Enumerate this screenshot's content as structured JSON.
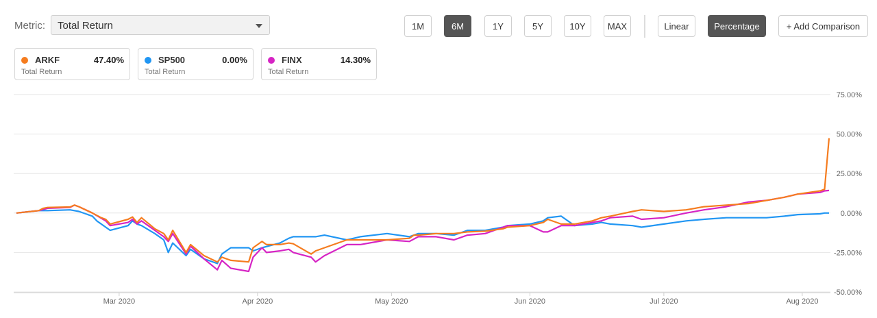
{
  "metric": {
    "label": "Metric:",
    "value": "Total Return"
  },
  "ranges": [
    "1M",
    "6M",
    "1Y",
    "5Y",
    "10Y",
    "MAX"
  ],
  "active_range": "6M",
  "scale_buttons": {
    "linear": "Linear",
    "percentage": "Percentage",
    "active": "Percentage"
  },
  "add_comparison": "+ Add Comparison",
  "cards": [
    {
      "symbol": "ARKF",
      "value": "47.40%",
      "sub": "Total Return",
      "color": "#f57c1f"
    },
    {
      "symbol": "SP500",
      "value": "0.00%",
      "sub": "Total Return",
      "color": "#2196f3"
    },
    {
      "symbol": "FINX",
      "value": "14.30%",
      "sub": "Total Return",
      "color": "#d624c4"
    }
  ],
  "chart_data": {
    "type": "line",
    "title": "",
    "xlabel": "",
    "ylabel": "",
    "ylim": [
      -50,
      75
    ],
    "yticks": [
      "75.00%",
      "50.00%",
      "25.00%",
      "0.00%",
      "-25.00%",
      "-50.00%"
    ],
    "ytick_values": [
      75,
      50,
      25,
      0,
      -25,
      -50
    ],
    "xticks": [
      "Mar 2020",
      "Apr 2020",
      "May 2020",
      "Jun 2020",
      "Jul 2020",
      "Aug 2020"
    ],
    "xtick_values": [
      "2020-03-01",
      "2020-04-01",
      "2020-05-01",
      "2020-06-01",
      "2020-07-01",
      "2020-08-01"
    ],
    "x_range": [
      "2020-02-07",
      "2020-08-07"
    ],
    "grid": true,
    "series": [
      {
        "name": "ARKF",
        "color": "#f57c1f",
        "points": [
          [
            "2020-02-07",
            0
          ],
          [
            "2020-02-12",
            1.5
          ],
          [
            "2020-02-13",
            3
          ],
          [
            "2020-02-14",
            3.5
          ],
          [
            "2020-02-19",
            3.8
          ],
          [
            "2020-02-20",
            5
          ],
          [
            "2020-02-21",
            4
          ],
          [
            "2020-02-24",
            0
          ],
          [
            "2020-02-26",
            -3
          ],
          [
            "2020-02-27",
            -4
          ],
          [
            "2020-02-28",
            -7
          ],
          [
            "2020-03-03",
            -4
          ],
          [
            "2020-03-04",
            -2.5
          ],
          [
            "2020-03-05",
            -6
          ],
          [
            "2020-03-06",
            -3
          ],
          [
            "2020-03-09",
            -10
          ],
          [
            "2020-03-11",
            -13
          ],
          [
            "2020-03-12",
            -17
          ],
          [
            "2020-03-13",
            -11
          ],
          [
            "2020-03-16",
            -25
          ],
          [
            "2020-03-17",
            -20
          ],
          [
            "2020-03-20",
            -27
          ],
          [
            "2020-03-23",
            -31
          ],
          [
            "2020-03-24",
            -28
          ],
          [
            "2020-03-26",
            -30
          ],
          [
            "2020-03-30",
            -31
          ],
          [
            "2020-03-31",
            -22
          ],
          [
            "2020-04-02",
            -18
          ],
          [
            "2020-04-03",
            -20
          ],
          [
            "2020-04-06",
            -20
          ],
          [
            "2020-04-08",
            -19
          ],
          [
            "2020-04-09",
            -19.5
          ],
          [
            "2020-04-13",
            -26
          ],
          [
            "2020-04-14",
            -24
          ],
          [
            "2020-04-16",
            -22
          ],
          [
            "2020-04-21",
            -17
          ],
          [
            "2020-04-24",
            -17
          ],
          [
            "2020-04-30",
            -17
          ],
          [
            "2020-05-05",
            -16
          ],
          [
            "2020-05-06",
            -14
          ],
          [
            "2020-05-07",
            -14
          ],
          [
            "2020-05-11",
            -13
          ],
          [
            "2020-05-15",
            -13
          ],
          [
            "2020-05-18",
            -12
          ],
          [
            "2020-05-22",
            -11.5
          ],
          [
            "2020-05-26",
            -10
          ],
          [
            "2020-05-27",
            -9
          ],
          [
            "2020-06-01",
            -8
          ],
          [
            "2020-06-04",
            -6
          ],
          [
            "2020-06-05",
            -4
          ],
          [
            "2020-06-08",
            -7
          ],
          [
            "2020-06-11",
            -7
          ],
          [
            "2020-06-15",
            -5
          ],
          [
            "2020-06-17",
            -3
          ],
          [
            "2020-06-19",
            -2
          ],
          [
            "2020-06-24",
            1
          ],
          [
            "2020-06-26",
            2
          ],
          [
            "2020-07-01",
            1
          ],
          [
            "2020-07-06",
            2
          ],
          [
            "2020-07-10",
            4
          ],
          [
            "2020-07-15",
            5
          ],
          [
            "2020-07-20",
            6
          ],
          [
            "2020-07-24",
            8
          ],
          [
            "2020-07-28",
            10
          ],
          [
            "2020-07-31",
            12
          ],
          [
            "2020-08-05",
            14
          ],
          [
            "2020-08-06",
            15
          ],
          [
            "2020-08-07",
            47.4
          ]
        ]
      },
      {
        "name": "SP500",
        "color": "#2196f3",
        "points": [
          [
            "2020-02-07",
            0
          ],
          [
            "2020-02-12",
            1.5
          ],
          [
            "2020-02-14",
            1.5
          ],
          [
            "2020-02-19",
            2
          ],
          [
            "2020-02-21",
            1
          ],
          [
            "2020-02-24",
            -2
          ],
          [
            "2020-02-25",
            -5
          ],
          [
            "2020-02-27",
            -9
          ],
          [
            "2020-02-28",
            -11
          ],
          [
            "2020-03-03",
            -8
          ],
          [
            "2020-03-04",
            -5
          ],
          [
            "2020-03-05",
            -7
          ],
          [
            "2020-03-06",
            -8
          ],
          [
            "2020-03-09",
            -13
          ],
          [
            "2020-03-11",
            -17
          ],
          [
            "2020-03-12",
            -25
          ],
          [
            "2020-03-13",
            -19
          ],
          [
            "2020-03-16",
            -27
          ],
          [
            "2020-03-17",
            -23
          ],
          [
            "2020-03-20",
            -29
          ],
          [
            "2020-03-23",
            -32
          ],
          [
            "2020-03-24",
            -26
          ],
          [
            "2020-03-26",
            -22
          ],
          [
            "2020-03-30",
            -22
          ],
          [
            "2020-03-31",
            -24
          ],
          [
            "2020-04-02",
            -22
          ],
          [
            "2020-04-06",
            -19
          ],
          [
            "2020-04-08",
            -16
          ],
          [
            "2020-04-09",
            -15
          ],
          [
            "2020-04-14",
            -15
          ],
          [
            "2020-04-16",
            -14
          ],
          [
            "2020-04-21",
            -17
          ],
          [
            "2020-04-24",
            -15
          ],
          [
            "2020-04-30",
            -13
          ],
          [
            "2020-05-05",
            -15
          ],
          [
            "2020-05-07",
            -13
          ],
          [
            "2020-05-11",
            -13
          ],
          [
            "2020-05-15",
            -14
          ],
          [
            "2020-05-18",
            -11
          ],
          [
            "2020-05-22",
            -11
          ],
          [
            "2020-05-26",
            -9
          ],
          [
            "2020-05-27",
            -8
          ],
          [
            "2020-06-01",
            -7
          ],
          [
            "2020-06-04",
            -5
          ],
          [
            "2020-06-05",
            -3
          ],
          [
            "2020-06-08",
            -2
          ],
          [
            "2020-06-11",
            -8
          ],
          [
            "2020-06-15",
            -7
          ],
          [
            "2020-06-17",
            -6
          ],
          [
            "2020-06-19",
            -7
          ],
          [
            "2020-06-24",
            -8
          ],
          [
            "2020-06-26",
            -9
          ],
          [
            "2020-07-01",
            -7
          ],
          [
            "2020-07-06",
            -5
          ],
          [
            "2020-07-10",
            -4
          ],
          [
            "2020-07-15",
            -3
          ],
          [
            "2020-07-20",
            -3
          ],
          [
            "2020-07-24",
            -3
          ],
          [
            "2020-07-28",
            -2
          ],
          [
            "2020-07-31",
            -1
          ],
          [
            "2020-08-05",
            -0.5
          ],
          [
            "2020-08-06",
            0
          ],
          [
            "2020-08-07",
            0
          ]
        ]
      },
      {
        "name": "FINX",
        "color": "#d624c4",
        "points": [
          [
            "2020-02-07",
            0
          ],
          [
            "2020-02-12",
            1.5
          ],
          [
            "2020-02-14",
            3
          ],
          [
            "2020-02-19",
            3.5
          ],
          [
            "2020-02-20",
            5
          ],
          [
            "2020-02-21",
            4
          ],
          [
            "2020-02-24",
            0
          ],
          [
            "2020-02-27",
            -5
          ],
          [
            "2020-02-28",
            -8
          ],
          [
            "2020-03-03",
            -6
          ],
          [
            "2020-03-04",
            -4
          ],
          [
            "2020-03-05",
            -7
          ],
          [
            "2020-03-06",
            -5
          ],
          [
            "2020-03-09",
            -11
          ],
          [
            "2020-03-11",
            -15
          ],
          [
            "2020-03-12",
            -18
          ],
          [
            "2020-03-13",
            -13
          ],
          [
            "2020-03-16",
            -26
          ],
          [
            "2020-03-17",
            -21
          ],
          [
            "2020-03-20",
            -29
          ],
          [
            "2020-03-23",
            -36
          ],
          [
            "2020-03-24",
            -30
          ],
          [
            "2020-03-26",
            -35
          ],
          [
            "2020-03-30",
            -37
          ],
          [
            "2020-03-31",
            -28
          ],
          [
            "2020-04-02",
            -22
          ],
          [
            "2020-04-03",
            -25
          ],
          [
            "2020-04-06",
            -24
          ],
          [
            "2020-04-08",
            -23
          ],
          [
            "2020-04-09",
            -25
          ],
          [
            "2020-04-13",
            -28
          ],
          [
            "2020-04-14",
            -31
          ],
          [
            "2020-04-16",
            -27
          ],
          [
            "2020-04-21",
            -20
          ],
          [
            "2020-04-24",
            -20
          ],
          [
            "2020-04-30",
            -17
          ],
          [
            "2020-05-05",
            -18
          ],
          [
            "2020-05-07",
            -15
          ],
          [
            "2020-05-11",
            -15
          ],
          [
            "2020-05-15",
            -17
          ],
          [
            "2020-05-18",
            -14
          ],
          [
            "2020-05-22",
            -13
          ],
          [
            "2020-05-26",
            -9
          ],
          [
            "2020-05-27",
            -8
          ],
          [
            "2020-06-01",
            -8
          ],
          [
            "2020-06-04",
            -12
          ],
          [
            "2020-06-05",
            -12
          ],
          [
            "2020-06-08",
            -8
          ],
          [
            "2020-06-11",
            -8
          ],
          [
            "2020-06-15",
            -6
          ],
          [
            "2020-06-17",
            -5
          ],
          [
            "2020-06-19",
            -3
          ],
          [
            "2020-06-24",
            -2
          ],
          [
            "2020-06-26",
            -4
          ],
          [
            "2020-07-01",
            -3
          ],
          [
            "2020-07-06",
            0
          ],
          [
            "2020-07-10",
            2
          ],
          [
            "2020-07-15",
            4
          ],
          [
            "2020-07-20",
            7
          ],
          [
            "2020-07-24",
            8
          ],
          [
            "2020-07-28",
            10
          ],
          [
            "2020-07-31",
            12
          ],
          [
            "2020-08-05",
            13
          ],
          [
            "2020-08-06",
            14
          ],
          [
            "2020-08-07",
            14.3
          ]
        ]
      }
    ]
  }
}
